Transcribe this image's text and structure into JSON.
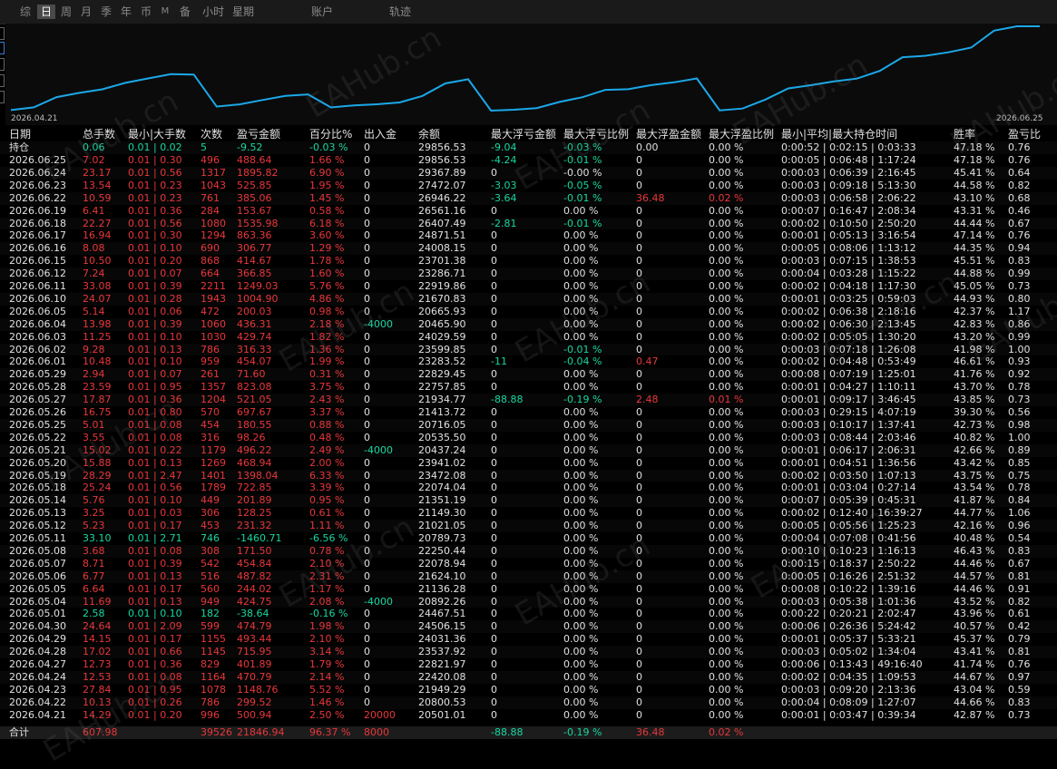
{
  "tabs": [
    {
      "label": "综",
      "active": false
    },
    {
      "label": "日",
      "active": true
    },
    {
      "label": "周",
      "active": false
    },
    {
      "label": "月",
      "active": false
    },
    {
      "label": "季",
      "active": false
    },
    {
      "label": "年",
      "active": false
    },
    {
      "label": "币",
      "active": false
    },
    {
      "label": "M",
      "active": false
    },
    {
      "label": "备",
      "active": false
    },
    {
      "label": "小时",
      "active": false
    },
    {
      "label": "星期",
      "active": false
    },
    {
      "label": "账户",
      "active": false
    },
    {
      "label": "轨迹",
      "active": false
    }
  ],
  "chart": {
    "start_date": "2026.04.21",
    "end_date": "2026.06.25",
    "line_color": "#1ba8e8"
  },
  "watermark": "EAHub.cn",
  "columns": {
    "date": "日期",
    "lots": "总手数",
    "minmax": "最小|大手数",
    "count": "次数",
    "pnl": "盈亏金额",
    "pct": "百分比%",
    "io": "出入金",
    "balance": "余额",
    "max_float_loss": "最大浮亏金额",
    "max_float_loss_pct": "最大浮亏比例",
    "max_float_profit": "最大浮盈金额",
    "max_float_profit_pct": "最大浮盈比例",
    "hold_time": "最小|平均|最大持仓时间",
    "win_rate": "胜率",
    "pl_ratio": "盈亏比"
  },
  "holding": {
    "date": "持仓",
    "lots": "0.06",
    "minmax": "0.01 | 0.02",
    "count": "5",
    "pnl": "-9.52",
    "pct": "-0.03 %",
    "io": "0",
    "balance": "29856.53",
    "mfl": "-9.04",
    "mflp": "-0.03 %",
    "mfp": "0.00",
    "mfpp": "0.00 %",
    "hold": "0:00:52 | 0:02:15 | 0:03:33",
    "win": "47.18 %",
    "ratio": "0.76"
  },
  "rows": [
    {
      "date": "2026.06.25",
      "lots": "7.02",
      "minmax": "0.01 | 0.30",
      "count": "496",
      "pnl": "488.64",
      "pct": "1.66 %",
      "io": "0",
      "balance": "29856.53",
      "mfl": "-4.24",
      "mflp": "-0.01 %",
      "mfp": "0",
      "mfpp": "0.00 %",
      "hold": "0:00:05 | 0:06:48 | 1:17:24",
      "win": "47.18 %",
      "ratio": "0.76"
    },
    {
      "date": "2026.06.24",
      "lots": "23.17",
      "minmax": "0.01 | 0.56",
      "count": "1317",
      "pnl": "1895.82",
      "pct": "6.90 %",
      "io": "0",
      "balance": "29367.89",
      "mfl": "0",
      "mflp": "-0.00 %",
      "mfp": "0",
      "mfpp": "0.00 %",
      "hold": "0:00:03 | 0:06:39 | 2:16:45",
      "win": "45.41 %",
      "ratio": "0.64"
    },
    {
      "date": "2026.06.23",
      "lots": "13.54",
      "minmax": "0.01 | 0.23",
      "count": "1043",
      "pnl": "525.85",
      "pct": "1.95 %",
      "io": "0",
      "balance": "27472.07",
      "mfl": "-3.03",
      "mflp": "-0.05 %",
      "mfp": "0",
      "mfpp": "0.00 %",
      "hold": "0:00:03 | 0:09:18 | 5:13:30",
      "win": "44.58 %",
      "ratio": "0.82"
    },
    {
      "date": "2026.06.22",
      "lots": "10.59",
      "minmax": "0.01 | 0.23",
      "count": "761",
      "pnl": "385.06",
      "pct": "1.45 %",
      "io": "0",
      "balance": "26946.22",
      "mfl": "-3.64",
      "mflp": "-0.01 %",
      "mfp": "36.48",
      "mfpp": "0.02 %",
      "hold": "0:00:03 | 0:06:58 | 2:06:22",
      "win": "43.10 %",
      "ratio": "0.68"
    },
    {
      "date": "2026.06.19",
      "lots": "6.41",
      "minmax": "0.01 | 0.36",
      "count": "284",
      "pnl": "153.67",
      "pct": "0.58 %",
      "io": "0",
      "balance": "26561.16",
      "mfl": "0",
      "mflp": "0.00 %",
      "mfp": "0",
      "mfpp": "0.00 %",
      "hold": "0:00:07 | 0:16:47 | 2:08:34",
      "win": "43.31 %",
      "ratio": "0.46"
    },
    {
      "date": "2026.06.18",
      "lots": "22.27",
      "minmax": "0.01 | 0.56",
      "count": "1080",
      "pnl": "1535.98",
      "pct": "6.18 %",
      "io": "0",
      "balance": "26407.49",
      "mfl": "-2.81",
      "mflp": "-0.01 %",
      "mfp": "0",
      "mfpp": "0.00 %",
      "hold": "0:00:02 | 0:10:50 | 2:50:20",
      "win": "44.44 %",
      "ratio": "0.67"
    },
    {
      "date": "2026.06.17",
      "lots": "16.94",
      "minmax": "0.01 | 0.30",
      "count": "1294",
      "pnl": "863.36",
      "pct": "3.60 %",
      "io": "0",
      "balance": "24871.51",
      "mfl": "0",
      "mflp": "0.00 %",
      "mfp": "0",
      "mfpp": "0.00 %",
      "hold": "0:00:01 | 0:05:13 | 3:16:54",
      "win": "47.14 %",
      "ratio": "0.76"
    },
    {
      "date": "2026.06.16",
      "lots": "8.08",
      "minmax": "0.01 | 0.10",
      "count": "690",
      "pnl": "306.77",
      "pct": "1.29 %",
      "io": "0",
      "balance": "24008.15",
      "mfl": "0",
      "mflp": "0.00 %",
      "mfp": "0",
      "mfpp": "0.00 %",
      "hold": "0:00:05 | 0:08:06 | 1:13:12",
      "win": "44.35 %",
      "ratio": "0.94"
    },
    {
      "date": "2026.06.15",
      "lots": "10.50",
      "minmax": "0.01 | 0.20",
      "count": "868",
      "pnl": "414.67",
      "pct": "1.78 %",
      "io": "0",
      "balance": "23701.38",
      "mfl": "0",
      "mflp": "0.00 %",
      "mfp": "0",
      "mfpp": "0.00 %",
      "hold": "0:00:03 | 0:07:15 | 1:38:53",
      "win": "45.51 %",
      "ratio": "0.83"
    },
    {
      "date": "2026.06.12",
      "lots": "7.24",
      "minmax": "0.01 | 0.07",
      "count": "664",
      "pnl": "366.85",
      "pct": "1.60 %",
      "io": "0",
      "balance": "23286.71",
      "mfl": "0",
      "mflp": "0.00 %",
      "mfp": "0",
      "mfpp": "0.00 %",
      "hold": "0:00:04 | 0:03:28 | 1:15:22",
      "win": "44.88 %",
      "ratio": "0.99"
    },
    {
      "date": "2026.06.11",
      "lots": "33.08",
      "minmax": "0.01 | 0.39",
      "count": "2211",
      "pnl": "1249.03",
      "pct": "5.76 %",
      "io": "0",
      "balance": "22919.86",
      "mfl": "0",
      "mflp": "0.00 %",
      "mfp": "0",
      "mfpp": "0.00 %",
      "hold": "0:00:02 | 0:04:18 | 1:17:30",
      "win": "45.05 %",
      "ratio": "0.73"
    },
    {
      "date": "2026.06.10",
      "lots": "24.07",
      "minmax": "0.01 | 0.28",
      "count": "1943",
      "pnl": "1004.90",
      "pct": "4.86 %",
      "io": "0",
      "balance": "21670.83",
      "mfl": "0",
      "mflp": "0.00 %",
      "mfp": "0",
      "mfpp": "0.00 %",
      "hold": "0:00:01 | 0:03:25 | 0:59:03",
      "win": "44.93 %",
      "ratio": "0.80"
    },
    {
      "date": "2026.06.05",
      "lots": "5.14",
      "minmax": "0.01 | 0.06",
      "count": "472",
      "pnl": "200.03",
      "pct": "0.98 %",
      "io": "0",
      "balance": "20665.93",
      "mfl": "0",
      "mflp": "0.00 %",
      "mfp": "0",
      "mfpp": "0.00 %",
      "hold": "0:00:02 | 0:06:38 | 2:18:16",
      "win": "42.37 %",
      "ratio": "1.17"
    },
    {
      "date": "2026.06.04",
      "lots": "13.98",
      "minmax": "0.01 | 0.39",
      "count": "1060",
      "pnl": "436.31",
      "pct": "2.18 %",
      "io": "-4000",
      "balance": "20465.90",
      "mfl": "0",
      "mflp": "0.00 %",
      "mfp": "0",
      "mfpp": "0.00 %",
      "hold": "0:00:02 | 0:06:30 | 2:13:45",
      "win": "42.83 %",
      "ratio": "0.86"
    },
    {
      "date": "2026.06.03",
      "lots": "11.25",
      "minmax": "0.01 | 0.10",
      "count": "1030",
      "pnl": "429.74",
      "pct": "1.82 %",
      "io": "0",
      "balance": "24029.59",
      "mfl": "0",
      "mflp": "0.00 %",
      "mfp": "0",
      "mfpp": "0.00 %",
      "hold": "0:00:02 | 0:05:05 | 1:30:20",
      "win": "43.20 %",
      "ratio": "0.99"
    },
    {
      "date": "2026.06.02",
      "lots": "9.28",
      "minmax": "0.01 | 0.13",
      "count": "786",
      "pnl": "316.33",
      "pct": "1.36 %",
      "io": "0",
      "balance": "23599.85",
      "mfl": "0",
      "mflp": "-0.01 %",
      "mfp": "0",
      "mfpp": "0.00 %",
      "hold": "0:00:03 | 0:07:18 | 1:26:08",
      "win": "41.98 %",
      "ratio": "1.00"
    },
    {
      "date": "2026.06.01",
      "lots": "10.48",
      "minmax": "0.01 | 0.10",
      "count": "959",
      "pnl": "454.07",
      "pct": "1.99 %",
      "io": "0",
      "balance": "23283.52",
      "mfl": "-11",
      "mflp": "-0.04 %",
      "mfp": "0.47",
      "mfpp": "0.00 %",
      "hold": "0:00:02 | 0:04:48 | 0:53:49",
      "win": "46.61 %",
      "ratio": "0.93"
    },
    {
      "date": "2026.05.29",
      "lots": "2.94",
      "minmax": "0.01 | 0.07",
      "count": "261",
      "pnl": "71.60",
      "pct": "0.31 %",
      "io": "0",
      "balance": "22829.45",
      "mfl": "0",
      "mflp": "0.00 %",
      "mfp": "0",
      "mfpp": "0.00 %",
      "hold": "0:00:08 | 0:07:19 | 1:25:01",
      "win": "41.76 %",
      "ratio": "0.92"
    },
    {
      "date": "2026.05.28",
      "lots": "23.59",
      "minmax": "0.01 | 0.95",
      "count": "1357",
      "pnl": "823.08",
      "pct": "3.75 %",
      "io": "0",
      "balance": "22757.85",
      "mfl": "0",
      "mflp": "0.00 %",
      "mfp": "0",
      "mfpp": "0.00 %",
      "hold": "0:00:01 | 0:04:27 | 1:10:11",
      "win": "43.70 %",
      "ratio": "0.78"
    },
    {
      "date": "2026.05.27",
      "lots": "17.87",
      "minmax": "0.01 | 0.36",
      "count": "1204",
      "pnl": "521.05",
      "pct": "2.43 %",
      "io": "0",
      "balance": "21934.77",
      "mfl": "-88.88",
      "mflp": "-0.19 %",
      "mfp": "2.48",
      "mfpp": "0.01 %",
      "hold": "0:00:01 | 0:09:17 | 3:46:45",
      "win": "43.85 %",
      "ratio": "0.73"
    },
    {
      "date": "2026.05.26",
      "lots": "16.75",
      "minmax": "0.01 | 0.80",
      "count": "570",
      "pnl": "697.67",
      "pct": "3.37 %",
      "io": "0",
      "balance": "21413.72",
      "mfl": "0",
      "mflp": "0.00 %",
      "mfp": "0",
      "mfpp": "0.00 %",
      "hold": "0:00:03 | 0:29:15 | 4:07:19",
      "win": "39.30 %",
      "ratio": "0.56"
    },
    {
      "date": "2026.05.25",
      "lots": "5.01",
      "minmax": "0.01 | 0.08",
      "count": "454",
      "pnl": "180.55",
      "pct": "0.88 %",
      "io": "0",
      "balance": "20716.05",
      "mfl": "0",
      "mflp": "0.00 %",
      "mfp": "0",
      "mfpp": "0.00 %",
      "hold": "0:00:03 | 0:10:17 | 1:37:41",
      "win": "42.73 %",
      "ratio": "0.98"
    },
    {
      "date": "2026.05.22",
      "lots": "3.55",
      "minmax": "0.01 | 0.08",
      "count": "316",
      "pnl": "98.26",
      "pct": "0.48 %",
      "io": "0",
      "balance": "20535.50",
      "mfl": "0",
      "mflp": "0.00 %",
      "mfp": "0",
      "mfpp": "0.00 %",
      "hold": "0:00:03 | 0:08:44 | 2:03:46",
      "win": "40.82 %",
      "ratio": "1.00"
    },
    {
      "date": "2026.05.21",
      "lots": "15.02",
      "minmax": "0.01 | 0.22",
      "count": "1179",
      "pnl": "496.22",
      "pct": "2.49 %",
      "io": "-4000",
      "balance": "20437.24",
      "mfl": "0",
      "mflp": "0.00 %",
      "mfp": "0",
      "mfpp": "0.00 %",
      "hold": "0:00:01 | 0:06:17 | 2:06:31",
      "win": "42.66 %",
      "ratio": "0.89"
    },
    {
      "date": "2026.05.20",
      "lots": "15.88",
      "minmax": "0.01 | 0.13",
      "count": "1269",
      "pnl": "468.94",
      "pct": "2.00 %",
      "io": "0",
      "balance": "23941.02",
      "mfl": "0",
      "mflp": "0.00 %",
      "mfp": "0",
      "mfpp": "0.00 %",
      "hold": "0:00:01 | 0:04:51 | 1:36:56",
      "win": "43.42 %",
      "ratio": "0.85"
    },
    {
      "date": "2026.05.19",
      "lots": "28.29",
      "minmax": "0.01 | 2.47",
      "count": "1401",
      "pnl": "1398.04",
      "pct": "6.33 %",
      "io": "0",
      "balance": "23472.08",
      "mfl": "0",
      "mflp": "0.00 %",
      "mfp": "0",
      "mfpp": "0.00 %",
      "hold": "0:00:02 | 0:03:50 | 1:07:13",
      "win": "43.75 %",
      "ratio": "0.75"
    },
    {
      "date": "2026.05.18",
      "lots": "25.24",
      "minmax": "0.01 | 0.56",
      "count": "1789",
      "pnl": "722.85",
      "pct": "3.39 %",
      "io": "0",
      "balance": "22074.04",
      "mfl": "0",
      "mflp": "0.00 %",
      "mfp": "0",
      "mfpp": "0.00 %",
      "hold": "0:00:01 | 0:03:04 | 0:27:14",
      "win": "43.54 %",
      "ratio": "0.78"
    },
    {
      "date": "2026.05.14",
      "lots": "5.76",
      "minmax": "0.01 | 0.10",
      "count": "449",
      "pnl": "201.89",
      "pct": "0.95 %",
      "io": "0",
      "balance": "21351.19",
      "mfl": "0",
      "mflp": "0.00 %",
      "mfp": "0",
      "mfpp": "0.00 %",
      "hold": "0:00:07 | 0:05:39 | 0:45:31",
      "win": "41.87 %",
      "ratio": "0.84"
    },
    {
      "date": "2026.05.13",
      "lots": "3.25",
      "minmax": "0.01 | 0.03",
      "count": "306",
      "pnl": "128.25",
      "pct": "0.61 %",
      "io": "0",
      "balance": "21149.30",
      "mfl": "0",
      "mflp": "0.00 %",
      "mfp": "0",
      "mfpp": "0.00 %",
      "hold": "0:00:02 | 0:12:40 | 16:39:27",
      "win": "44.77 %",
      "ratio": "1.06"
    },
    {
      "date": "2026.05.12",
      "lots": "5.23",
      "minmax": "0.01 | 0.17",
      "count": "453",
      "pnl": "231.32",
      "pct": "1.11 %",
      "io": "0",
      "balance": "21021.05",
      "mfl": "0",
      "mflp": "0.00 %",
      "mfp": "0",
      "mfpp": "0.00 %",
      "hold": "0:00:05 | 0:05:56 | 1:25:23",
      "win": "42.16 %",
      "ratio": "0.96"
    },
    {
      "date": "2026.05.11",
      "lots": "33.10",
      "minmax": "0.01 | 2.71",
      "count": "746",
      "pnl": "-1460.71",
      "pct": "-6.56 %",
      "io": "0",
      "balance": "20789.73",
      "mfl": "0",
      "mflp": "0.00 %",
      "mfp": "0",
      "mfpp": "0.00 %",
      "hold": "0:00:04 | 0:07:08 | 0:41:56",
      "win": "40.48 %",
      "ratio": "0.54"
    },
    {
      "date": "2026.05.08",
      "lots": "3.68",
      "minmax": "0.01 | 0.08",
      "count": "308",
      "pnl": "171.50",
      "pct": "0.78 %",
      "io": "0",
      "balance": "22250.44",
      "mfl": "0",
      "mflp": "0.00 %",
      "mfp": "0",
      "mfpp": "0.00 %",
      "hold": "0:00:10 | 0:10:23 | 1:16:13",
      "win": "46.43 %",
      "ratio": "0.83"
    },
    {
      "date": "2026.05.07",
      "lots": "8.71",
      "minmax": "0.01 | 0.39",
      "count": "542",
      "pnl": "454.84",
      "pct": "2.10 %",
      "io": "0",
      "balance": "22078.94",
      "mfl": "0",
      "mflp": "0.00 %",
      "mfp": "0",
      "mfpp": "0.00 %",
      "hold": "0:00:15 | 0:18:37 | 2:50:22",
      "win": "44.46 %",
      "ratio": "0.67"
    },
    {
      "date": "2026.05.06",
      "lots": "6.77",
      "minmax": "0.01 | 0.13",
      "count": "516",
      "pnl": "487.82",
      "pct": "2.31 %",
      "io": "0",
      "balance": "21624.10",
      "mfl": "0",
      "mflp": "0.00 %",
      "mfp": "0",
      "mfpp": "0.00 %",
      "hold": "0:00:05 | 0:16:26 | 2:51:32",
      "win": "44.57 %",
      "ratio": "0.81"
    },
    {
      "date": "2026.05.05",
      "lots": "6.64",
      "minmax": "0.01 | 0.17",
      "count": "560",
      "pnl": "244.02",
      "pct": "1.17 %",
      "io": "0",
      "balance": "21136.28",
      "mfl": "0",
      "mflp": "0.00 %",
      "mfp": "0",
      "mfpp": "0.00 %",
      "hold": "0:00:08 | 0:10:22 | 1:39:16",
      "win": "44.46 %",
      "ratio": "0.91"
    },
    {
      "date": "2026.05.04",
      "lots": "11.69",
      "minmax": "0.01 | 0.13",
      "count": "949",
      "pnl": "424.75",
      "pct": "2.08 %",
      "io": "-4000",
      "balance": "20892.26",
      "mfl": "0",
      "mflp": "0.00 %",
      "mfp": "0",
      "mfpp": "0.00 %",
      "hold": "0:00:03 | 0:05:38 | 1:01:36",
      "win": "43.52 %",
      "ratio": "0.82"
    },
    {
      "date": "2026.05.01",
      "lots": "2.58",
      "minmax": "0.01 | 0.10",
      "count": "182",
      "pnl": "-38.64",
      "pct": "-0.16 %",
      "io": "0",
      "balance": "24467.51",
      "mfl": "0",
      "mflp": "0.00 %",
      "mfp": "0",
      "mfpp": "0.00 %",
      "hold": "0:00:22 | 0:20:21 | 2:02:47",
      "win": "43.96 %",
      "ratio": "0.61"
    },
    {
      "date": "2026.04.30",
      "lots": "24.64",
      "minmax": "0.01 | 2.09",
      "count": "599",
      "pnl": "474.79",
      "pct": "1.98 %",
      "io": "0",
      "balance": "24506.15",
      "mfl": "0",
      "mflp": "0.00 %",
      "mfp": "0",
      "mfpp": "0.00 %",
      "hold": "0:00:06 | 0:26:36 | 5:24:42",
      "win": "40.57 %",
      "ratio": "0.42"
    },
    {
      "date": "2026.04.29",
      "lots": "14.15",
      "minmax": "0.01 | 0.17",
      "count": "1155",
      "pnl": "493.44",
      "pct": "2.10 %",
      "io": "0",
      "balance": "24031.36",
      "mfl": "0",
      "mflp": "0.00 %",
      "mfp": "0",
      "mfpp": "0.00 %",
      "hold": "0:00:01 | 0:05:37 | 5:33:21",
      "win": "45.37 %",
      "ratio": "0.79"
    },
    {
      "date": "2026.04.28",
      "lots": "17.02",
      "minmax": "0.01 | 0.66",
      "count": "1145",
      "pnl": "715.95",
      "pct": "3.14 %",
      "io": "0",
      "balance": "23537.92",
      "mfl": "0",
      "mflp": "0.00 %",
      "mfp": "0",
      "mfpp": "0.00 %",
      "hold": "0:00:03 | 0:05:02 | 1:34:04",
      "win": "43.41 %",
      "ratio": "0.81"
    },
    {
      "date": "2026.04.27",
      "lots": "12.73",
      "minmax": "0.01 | 0.36",
      "count": "829",
      "pnl": "401.89",
      "pct": "1.79 %",
      "io": "0",
      "balance": "22821.97",
      "mfl": "0",
      "mflp": "0.00 %",
      "mfp": "0",
      "mfpp": "0.00 %",
      "hold": "0:00:06 | 0:13:43 | 49:16:40",
      "win": "41.74 %",
      "ratio": "0.76"
    },
    {
      "date": "2026.04.24",
      "lots": "12.53",
      "minmax": "0.01 | 0.08",
      "count": "1164",
      "pnl": "470.79",
      "pct": "2.14 %",
      "io": "0",
      "balance": "22420.08",
      "mfl": "0",
      "mflp": "0.00 %",
      "mfp": "0",
      "mfpp": "0.00 %",
      "hold": "0:00:02 | 0:04:35 | 1:09:53",
      "win": "44.67 %",
      "ratio": "0.97"
    },
    {
      "date": "2026.04.23",
      "lots": "27.84",
      "minmax": "0.01 | 0.95",
      "count": "1078",
      "pnl": "1148.76",
      "pct": "5.52 %",
      "io": "0",
      "balance": "21949.29",
      "mfl": "0",
      "mflp": "0.00 %",
      "mfp": "0",
      "mfpp": "0.00 %",
      "hold": "0:00:03 | 0:09:20 | 2:13:36",
      "win": "43.04 %",
      "ratio": "0.59"
    },
    {
      "date": "2026.04.22",
      "lots": "10.13",
      "minmax": "0.01 | 0.26",
      "count": "786",
      "pnl": "299.52",
      "pct": "1.46 %",
      "io": "0",
      "balance": "20800.53",
      "mfl": "0",
      "mflp": "0.00 %",
      "mfp": "0",
      "mfpp": "0.00 %",
      "hold": "0:00:04 | 0:08:09 | 1:27:07",
      "win": "44.66 %",
      "ratio": "0.83"
    },
    {
      "date": "2026.04.21",
      "lots": "14.29",
      "minmax": "0.01 | 0.20",
      "count": "996",
      "pnl": "500.94",
      "pct": "2.50 %",
      "io": "20000",
      "balance": "20501.01",
      "mfl": "0",
      "mflp": "0.00 %",
      "mfp": "0",
      "mfpp": "0.00 %",
      "hold": "0:00:01 | 0:03:47 | 0:39:34",
      "win": "42.87 %",
      "ratio": "0.73"
    }
  ],
  "total": {
    "date": "合计",
    "lots": "607.98",
    "minmax": "",
    "count": "39526",
    "pnl": "21846.94",
    "pct": "96.37 %",
    "io": "8000",
    "balance": "",
    "mfl": "-88.88",
    "mflp": "-0.19 %",
    "mfp": "36.48",
    "mfpp": "0.02 %",
    "hold": "",
    "win": "",
    "ratio": ""
  },
  "colors": {
    "profit": "#e8373b",
    "loss": "#18d6a0",
    "text": "#e0e0e0",
    "curve": "#1ba8e8"
  }
}
